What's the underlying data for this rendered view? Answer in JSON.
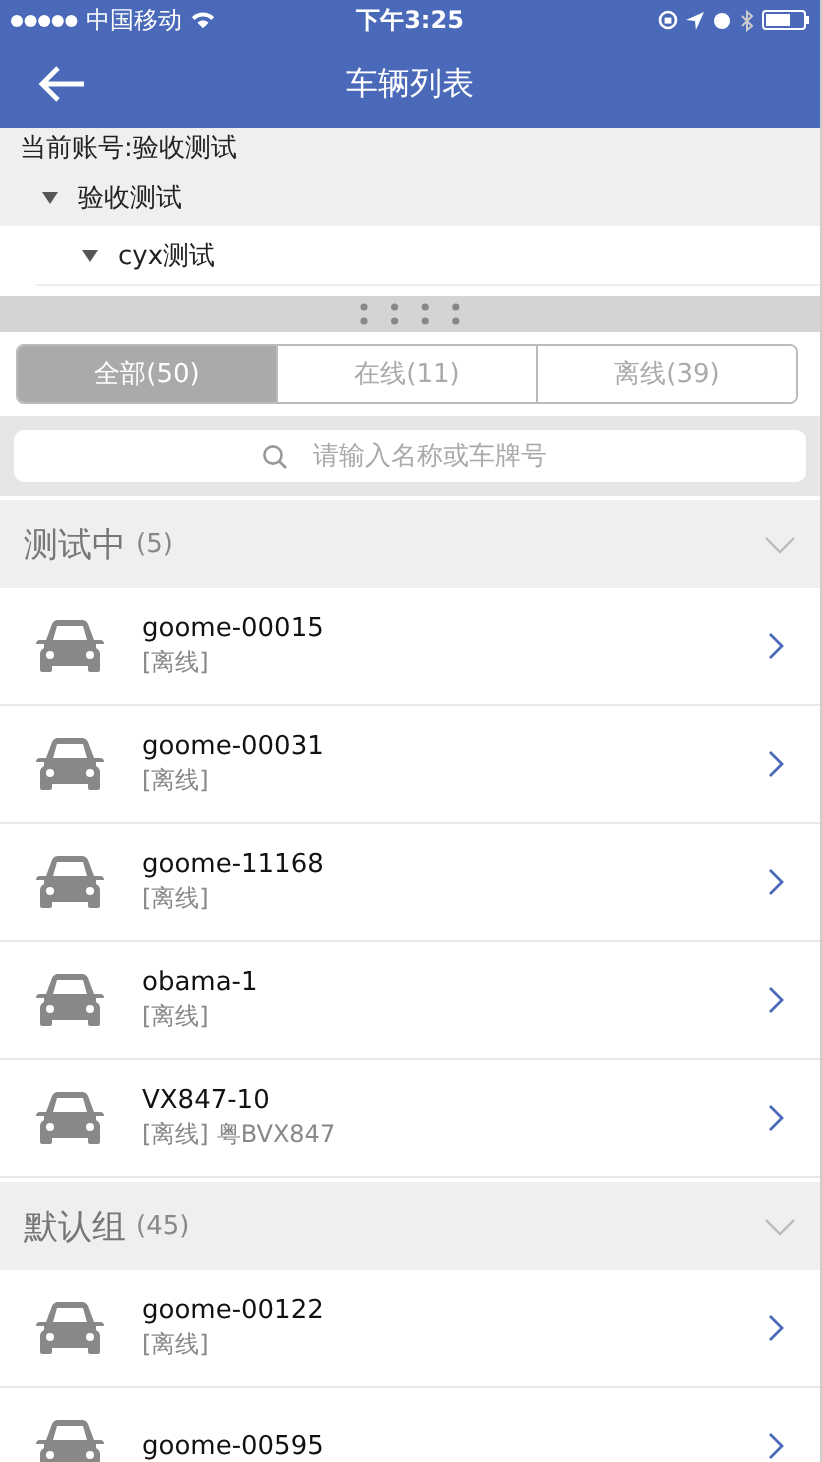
{
  "status_bar": {
    "carrier": "中国移动",
    "time": "下午3:25"
  },
  "nav": {
    "title": "车辆列表"
  },
  "account": {
    "label": "当前账号:验收测试"
  },
  "tree": [
    {
      "label": "验收测试",
      "expanded": true,
      "children": [
        {
          "label": "cyx测试",
          "expanded": true
        }
      ]
    }
  ],
  "tabs": [
    {
      "label": "全部(50)",
      "selected": true
    },
    {
      "label": "在线(11)",
      "selected": false
    },
    {
      "label": "离线(39)",
      "selected": false
    }
  ],
  "search": {
    "placeholder": "请输入名称或车牌号"
  },
  "groups": [
    {
      "name": "测试中",
      "count": "(5)",
      "vehicles": [
        {
          "name": "goome-00015",
          "status": "[离线]"
        },
        {
          "name": "goome-00031",
          "status": "[离线]"
        },
        {
          "name": "goome-11168",
          "status": "[离线]"
        },
        {
          "name": "obama-1",
          "status": "[离线]"
        },
        {
          "name": "VX847-10",
          "status": "[离线]",
          "plate": "粤BVX847"
        }
      ]
    },
    {
      "name": "默认组",
      "count": "(45)",
      "vehicles": [
        {
          "name": "goome-00122",
          "status": "[离线]"
        },
        {
          "name": "goome-00595"
        }
      ]
    }
  ]
}
